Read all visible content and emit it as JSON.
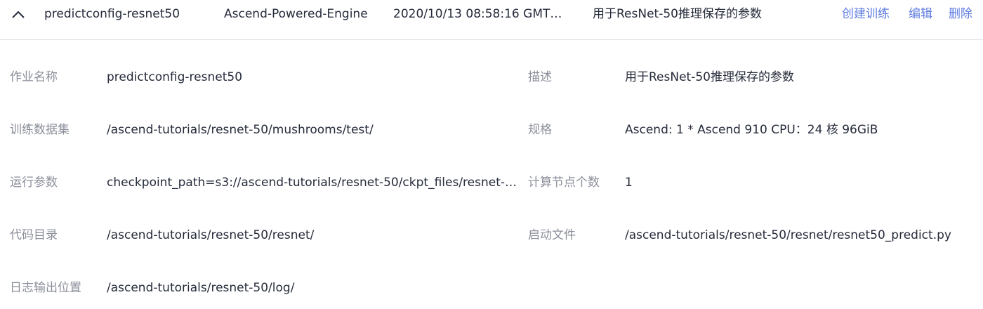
{
  "job_row": {
    "name": "predictconfig-resnet50",
    "engine": "Ascend-Powered-Engine",
    "created_time": "2020/10/13 08:58:16 GMT+0...",
    "description": "用于ResNet-50推理保存的参数",
    "actions": {
      "create_training": "创建训练",
      "edit": "编辑",
      "delete": "删除"
    },
    "expand_icon": "chevron-up-icon",
    "link_color": "#5e7ce0"
  },
  "details": {
    "job_name": {
      "label": "作业名称",
      "value": "predictconfig-resnet50"
    },
    "description": {
      "label": "描述",
      "value": "用于ResNet-50推理保存的参数"
    },
    "training_dataset": {
      "label": "训练数据集",
      "value": "/ascend-tutorials/resnet-50/mushrooms/test/"
    },
    "spec": {
      "label": "规格",
      "value": "Ascend: 1 * Ascend 910 CPU：24 核 96GiB"
    },
    "run_params": {
      "label": "运行参数",
      "value": "checkpoint_path=s3://ascend-tutorials/resnet-50/ckpt_files/resnet-50_2..."
    },
    "node_count": {
      "label": "计算节点个数",
      "value": "1"
    },
    "code_dir": {
      "label": "代码目录",
      "value": "/ascend-tutorials/resnet-50/resnet/"
    },
    "boot_file": {
      "label": "启动文件",
      "value": "/ascend-tutorials/resnet-50/resnet/resnet50_predict.py"
    },
    "log_output": {
      "label": "日志输出位置",
      "value": "/ascend-tutorials/resnet-50/log/"
    }
  }
}
